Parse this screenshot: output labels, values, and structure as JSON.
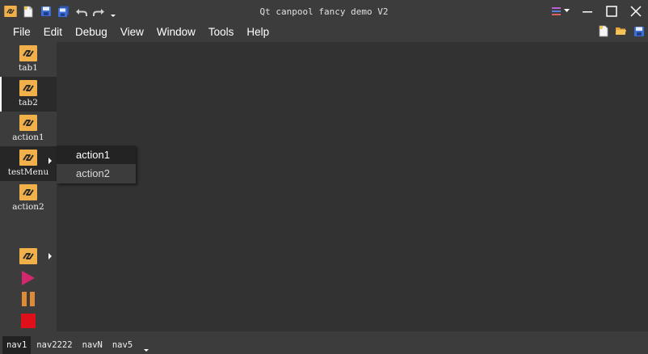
{
  "window": {
    "title": "Qt canpool fancy demo V2"
  },
  "menubar": {
    "items": [
      {
        "label": "File"
      },
      {
        "label": "Edit"
      },
      {
        "label": "Debug"
      },
      {
        "label": "View"
      },
      {
        "label": "Window"
      },
      {
        "label": "Tools"
      },
      {
        "label": "Help"
      }
    ]
  },
  "sidebar": {
    "items": [
      {
        "label": "tab1",
        "icon": "chain-link-icon"
      },
      {
        "label": "tab2",
        "icon": "chain-link-icon",
        "selected": true
      },
      {
        "label": "action1",
        "icon": "chain-link-icon"
      },
      {
        "label": "testMenu",
        "icon": "chain-link-icon",
        "has_submenu": true
      },
      {
        "label": "action2",
        "icon": "chain-link-icon"
      }
    ],
    "bottom_buttons": [
      "chain-link-icon",
      "play-icon",
      "pause-icon",
      "stop-icon"
    ]
  },
  "popup_menu": {
    "items": [
      {
        "label": "action1",
        "active": true
      },
      {
        "label": "action2",
        "active": false
      }
    ]
  },
  "navbar": {
    "tabs": [
      {
        "label": "nav1",
        "selected": true
      },
      {
        "label": "nav2222"
      },
      {
        "label": "navN"
      },
      {
        "label": "nav5"
      }
    ]
  },
  "colors": {
    "chrome": "#3c3c3c",
    "main_bg": "#323232",
    "icon_orange": "#f2b04b",
    "play": "#d4286e",
    "pause": "#e08a36",
    "stop": "#e0101a"
  }
}
